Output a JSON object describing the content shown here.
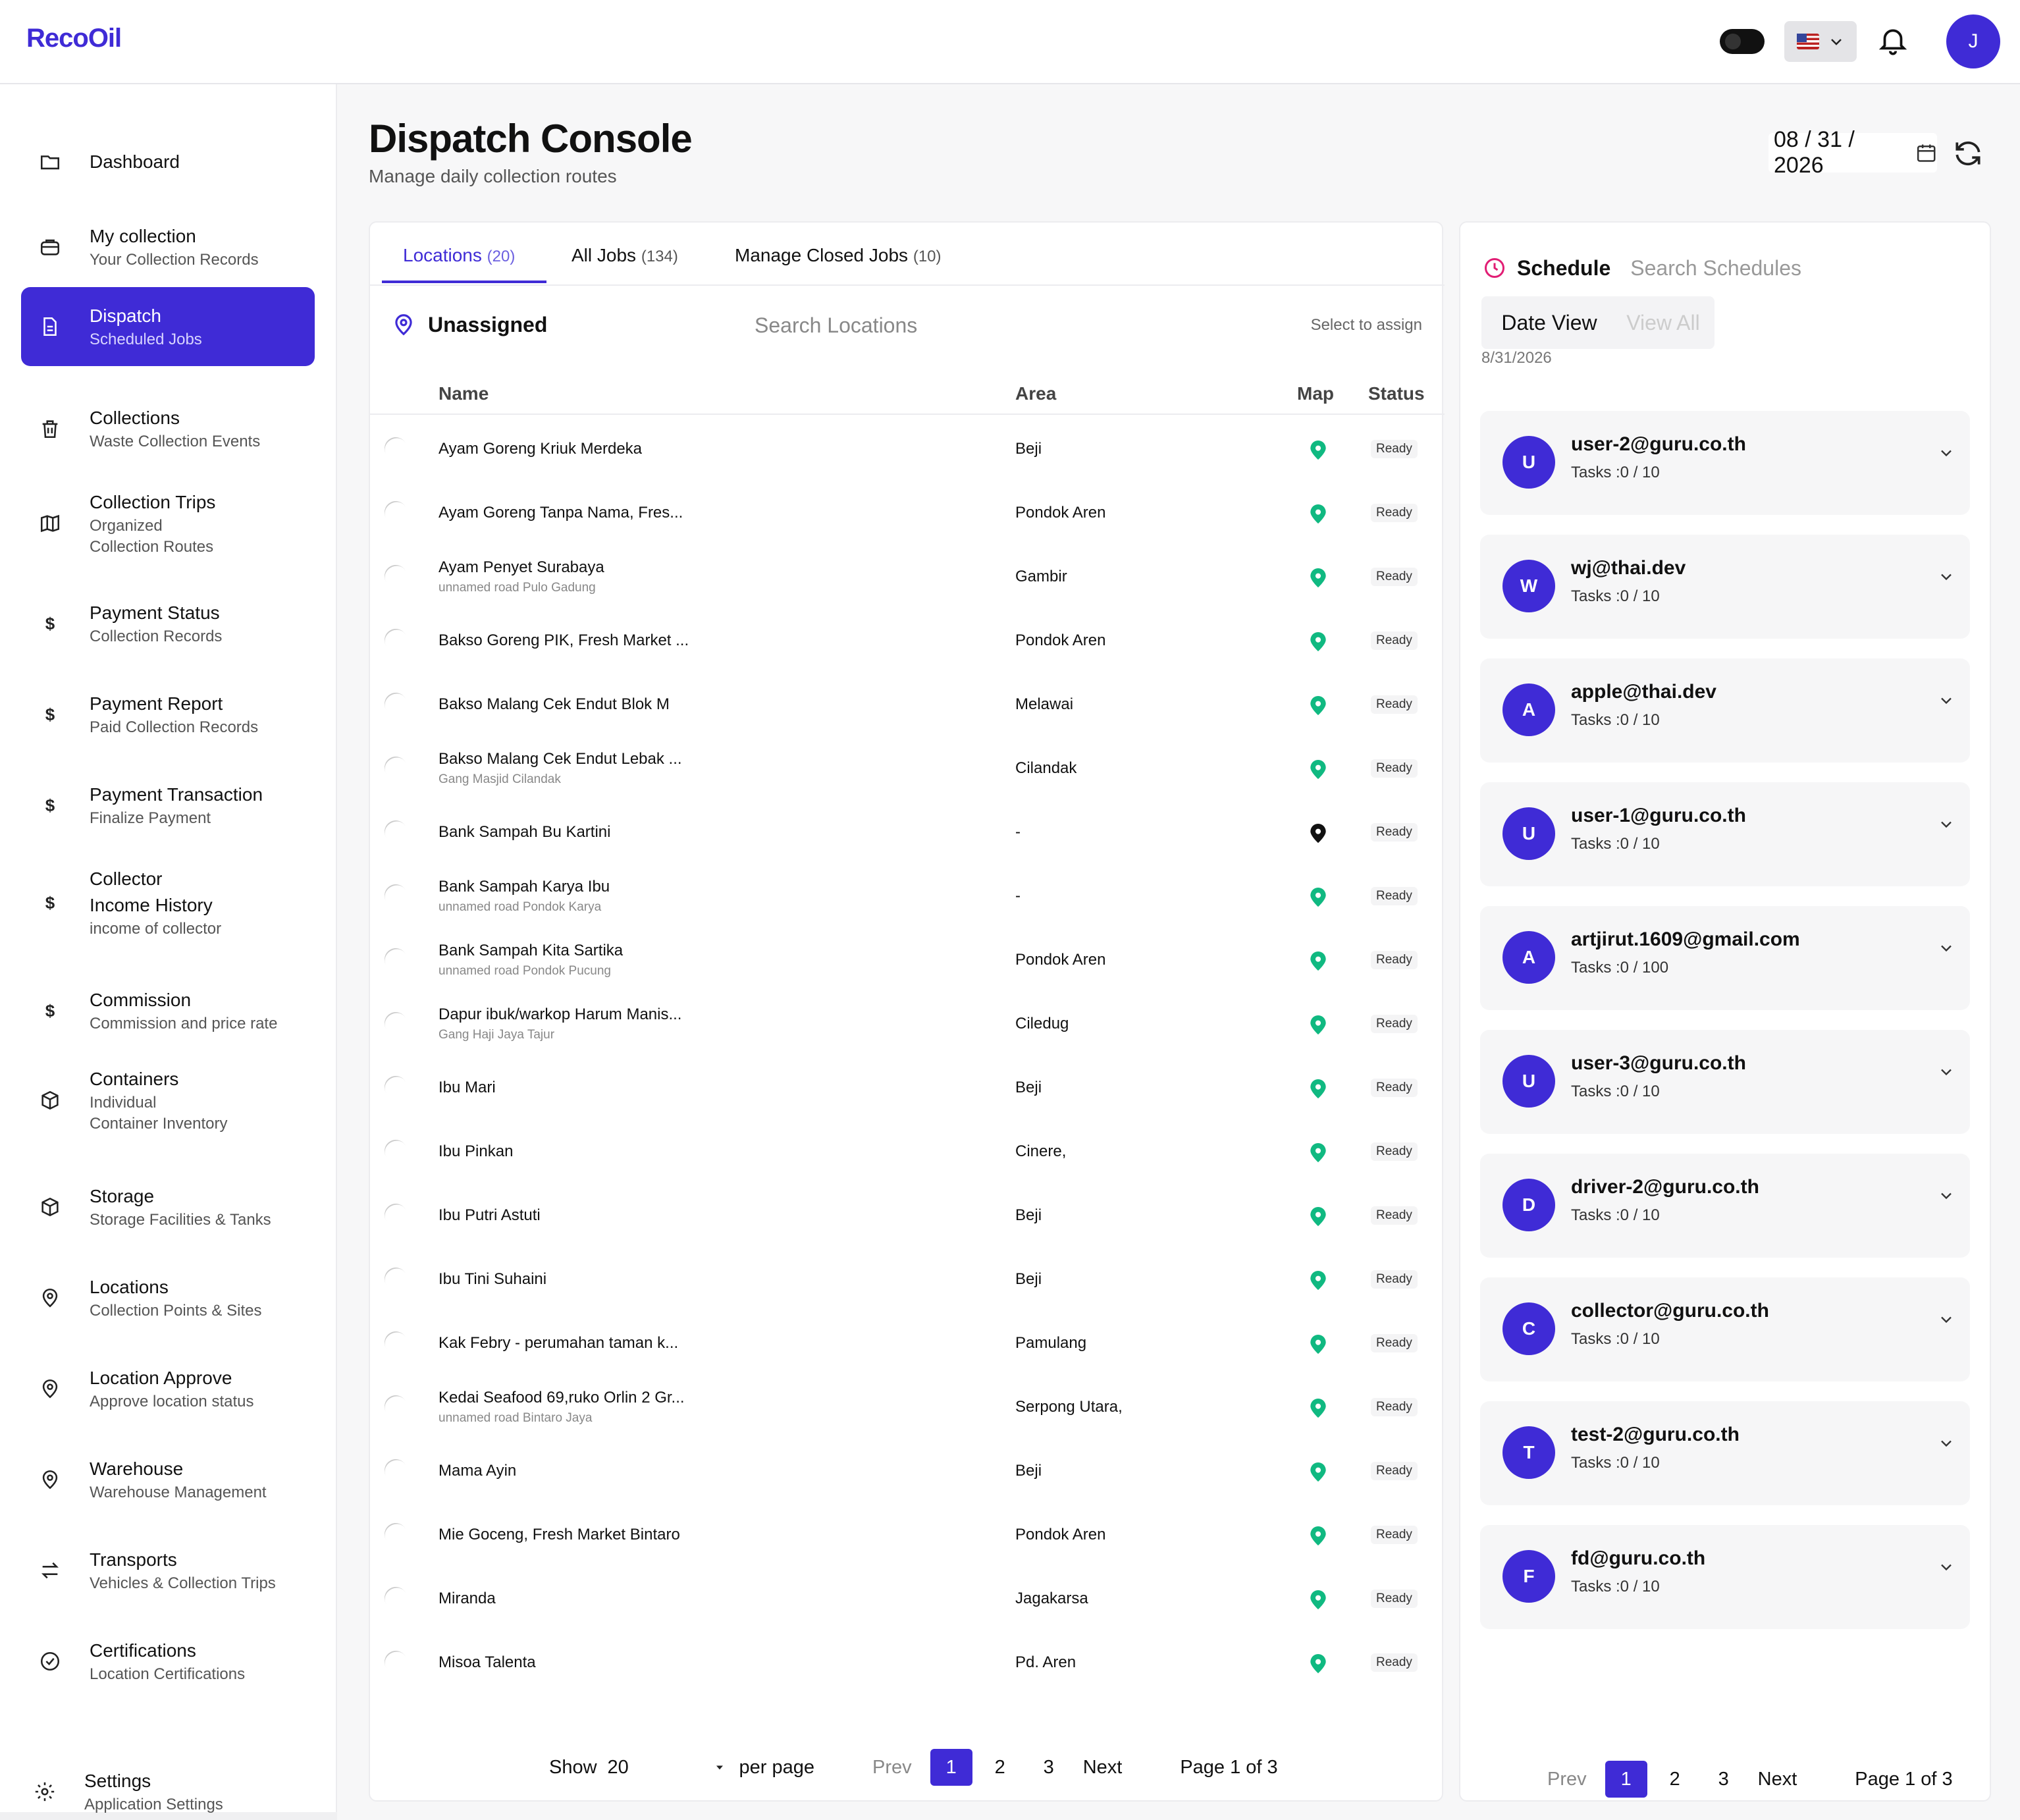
{
  "app": {
    "logo": "RecoOil",
    "avatar_initial": "J",
    "colors": {
      "accent": "#3f2bd6",
      "pin_green": "#10b981",
      "pin_dark": "#111111",
      "schedule_icon": "#e11d74"
    }
  },
  "sidebar": {
    "items": [
      {
        "title": "Dashboard",
        "sub": "",
        "icon": "folder-icon"
      },
      {
        "title": "My collection",
        "sub": "Your Collection Records",
        "icon": "bag-icon"
      },
      {
        "title": "Dispatch",
        "sub": "Scheduled Jobs",
        "icon": "document-icon",
        "active": true
      },
      {
        "title": "Collections",
        "sub": "Waste Collection Events",
        "icon": "trash-icon"
      },
      {
        "title": "Collection Trips",
        "sub": "Organized",
        "sub2": "Collection Routes",
        "icon": "map-icon"
      },
      {
        "title": "Payment Status",
        "sub": "Collection Records",
        "icon": "dollar-icon"
      },
      {
        "title": "Payment Report",
        "sub": "Paid Collection Records",
        "icon": "dollar-icon"
      },
      {
        "title": "Payment Transaction",
        "sub": "Finalize Payment",
        "icon": "dollar-icon"
      },
      {
        "title": "Collector",
        "title2": "Income History",
        "sub": "income of collector",
        "icon": "dollar-icon"
      },
      {
        "title": "Commission",
        "sub": "Commission and price rate",
        "icon": "dollar-icon"
      },
      {
        "title": "Containers",
        "sub": "Individual",
        "sub2": "Container Inventory",
        "icon": "box-icon"
      },
      {
        "title": "Storage",
        "sub": "Storage Facilities & Tanks",
        "icon": "box-icon"
      },
      {
        "title": "Locations",
        "sub": "Collection Points & Sites",
        "icon": "pin-icon"
      },
      {
        "title": "Location Approve",
        "sub": "Approve location status",
        "icon": "pin-icon"
      },
      {
        "title": "Warehouse",
        "sub": "Warehouse Management",
        "icon": "pin-icon"
      },
      {
        "title": "Transports",
        "sub": "Vehicles & Collection Trips",
        "icon": "transfer-icon"
      },
      {
        "title": "Certifications",
        "sub": "Location Certifications",
        "icon": "check-circle-icon"
      }
    ],
    "settings": {
      "title": "Settings",
      "sub": "Application Settings"
    }
  },
  "header": {
    "title": "Dispatch Console",
    "subtitle": "Manage daily collection routes",
    "date": "08 / 31 / 2026"
  },
  "tabs": [
    {
      "label": "Locations",
      "count": "(20)"
    },
    {
      "label": "All Jobs",
      "count": "(134)"
    },
    {
      "label": "Manage Closed Jobs",
      "count": "(10)"
    }
  ],
  "unassigned": {
    "title": "Unassigned",
    "search_placeholder": "Search Locations",
    "hint": "Select to assign"
  },
  "table": {
    "headers": {
      "name": "Name",
      "area": "Area",
      "map": "Map",
      "status": "Status"
    },
    "rows": [
      {
        "name": "Ayam Goreng Kriuk Merdeka",
        "addr": "",
        "area": "Beji",
        "pin": "green",
        "status": "Ready"
      },
      {
        "name": "Ayam Goreng Tanpa Nama, Fres...",
        "addr": "",
        "area": "Pondok Aren",
        "pin": "green",
        "status": "Ready"
      },
      {
        "name": "Ayam Penyet Surabaya",
        "addr": "unnamed road Pulo Gadung",
        "area": "Gambir",
        "pin": "green",
        "status": "Ready"
      },
      {
        "name": "Bakso Goreng PIK, Fresh Market ...",
        "addr": "",
        "area": "Pondok Aren",
        "pin": "green",
        "status": "Ready"
      },
      {
        "name": "Bakso Malang Cek Endut Blok M",
        "addr": "",
        "area": "Melawai",
        "pin": "green",
        "status": "Ready"
      },
      {
        "name": "Bakso Malang Cek Endut Lebak ...",
        "addr": "Gang Masjid Cilandak",
        "area": "Cilandak",
        "pin": "green",
        "status": "Ready"
      },
      {
        "name": "Bank Sampah Bu Kartini",
        "addr": "",
        "area": "-",
        "pin": "dark",
        "status": "Ready"
      },
      {
        "name": "Bank Sampah Karya Ibu",
        "addr": "unnamed road Pondok Karya",
        "area": "-",
        "pin": "green",
        "status": "Ready"
      },
      {
        "name": "Bank Sampah Kita Sartika",
        "addr": "unnamed road Pondok Pucung",
        "area": "Pondok Aren",
        "pin": "green",
        "status": "Ready"
      },
      {
        "name": "Dapur ibuk/warkop Harum Manis...",
        "addr": "Gang Haji Jaya Tajur",
        "area": "Ciledug",
        "pin": "green",
        "status": "Ready"
      },
      {
        "name": "Ibu Mari",
        "addr": "",
        "area": "Beji",
        "pin": "green",
        "status": "Ready"
      },
      {
        "name": "Ibu Pinkan",
        "addr": "",
        "area": "Cinere,",
        "pin": "green",
        "status": "Ready"
      },
      {
        "name": "Ibu Putri Astuti",
        "addr": "",
        "area": "Beji",
        "pin": "green",
        "status": "Ready"
      },
      {
        "name": "Ibu Tini Suhaini",
        "addr": "",
        "area": "Beji",
        "pin": "green",
        "status": "Ready"
      },
      {
        "name": "Kak Febry - perumahan taman k...",
        "addr": "",
        "area": "Pamulang",
        "pin": "green",
        "status": "Ready"
      },
      {
        "name": "Kedai Seafood 69,ruko Orlin 2 Gr...",
        "addr": "unnamed road Bintaro Jaya",
        "area": "Serpong Utara,",
        "pin": "green",
        "status": "Ready"
      },
      {
        "name": "Mama Ayin",
        "addr": "",
        "area": "Beji",
        "pin": "green",
        "status": "Ready"
      },
      {
        "name": "Mie Goceng, Fresh Market Bintaro",
        "addr": "",
        "area": "Pondok Aren",
        "pin": "green",
        "status": "Ready"
      },
      {
        "name": "Miranda",
        "addr": "",
        "area": "Jagakarsa",
        "pin": "green",
        "status": "Ready"
      },
      {
        "name": "Misoa Talenta",
        "addr": "",
        "area": "Pd. Aren",
        "pin": "green",
        "status": "Ready"
      }
    ]
  },
  "pager_main": {
    "show": "Show",
    "page_size": "20",
    "per_page": "per page",
    "prev": "Prev",
    "pages": [
      "1",
      "2",
      "3"
    ],
    "next": "Next",
    "page_of": "Page 1 of 3"
  },
  "schedule": {
    "title": "Schedule",
    "search_placeholder": "Search Schedules",
    "date_view": "Date View",
    "view_all": "View All",
    "date": "8/31/2026",
    "users": [
      {
        "initial": "U",
        "email": "user-2@guru.co.th",
        "tasks": "Tasks :0 / 10"
      },
      {
        "initial": "W",
        "email": "wj@thai.dev",
        "tasks": "Tasks :0 / 10"
      },
      {
        "initial": "A",
        "email": "apple@thai.dev",
        "tasks": "Tasks :0 / 10"
      },
      {
        "initial": "U",
        "email": "user-1@guru.co.th",
        "tasks": "Tasks :0 / 10"
      },
      {
        "initial": "A",
        "email": "artjirut.1609@gmail.com",
        "tasks": "Tasks :0 / 100"
      },
      {
        "initial": "U",
        "email": "user-3@guru.co.th",
        "tasks": "Tasks :0 / 10"
      },
      {
        "initial": "D",
        "email": "driver-2@guru.co.th",
        "tasks": "Tasks :0 / 10"
      },
      {
        "initial": "C",
        "email": "collector@guru.co.th",
        "tasks": "Tasks :0 / 10"
      },
      {
        "initial": "T",
        "email": "test-2@guru.co.th",
        "tasks": "Tasks :0 / 10"
      },
      {
        "initial": "F",
        "email": "fd@guru.co.th",
        "tasks": "Tasks :0 / 10"
      }
    ]
  },
  "pager_sched": {
    "prev": "Prev",
    "pages": [
      "1",
      "2",
      "3"
    ],
    "next": "Next",
    "page_of": "Page 1 of 3"
  }
}
